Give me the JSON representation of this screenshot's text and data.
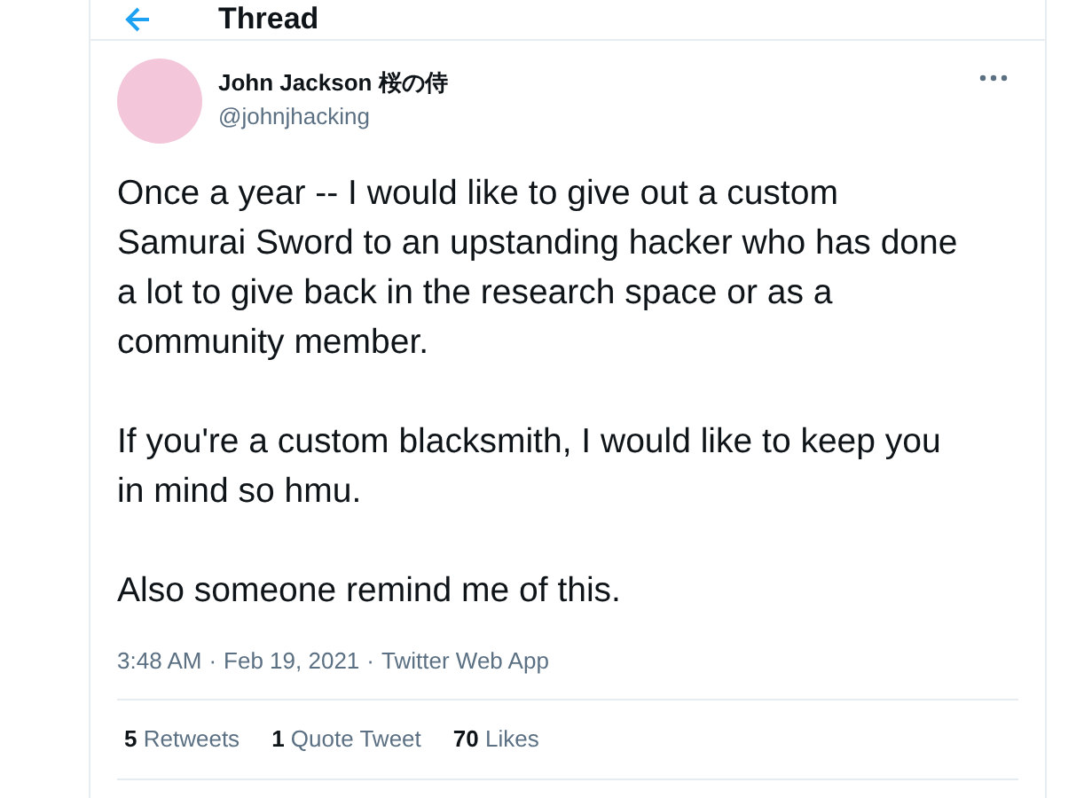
{
  "header": {
    "title": "Thread"
  },
  "tweet": {
    "author": {
      "name": "John Jackson 桜の侍",
      "handle": "@johnjhacking"
    },
    "paragraphs": [
      "Once a year -- I would like to give out a custom Samurai Sword to an upstanding hacker who has done a lot to give back in the research space or as a community member.",
      "If you're a custom blacksmith, I would like to keep you in mind so hmu.",
      "Also someone remind me of this."
    ],
    "time": "3:48 AM",
    "separator": "·",
    "date": "Feb 19, 2021",
    "source": "Twitter Web App",
    "stats": [
      {
        "count": "5",
        "label": "Retweets"
      },
      {
        "count": "1",
        "label": "Quote Tweet"
      },
      {
        "count": "70",
        "label": "Likes"
      }
    ]
  }
}
